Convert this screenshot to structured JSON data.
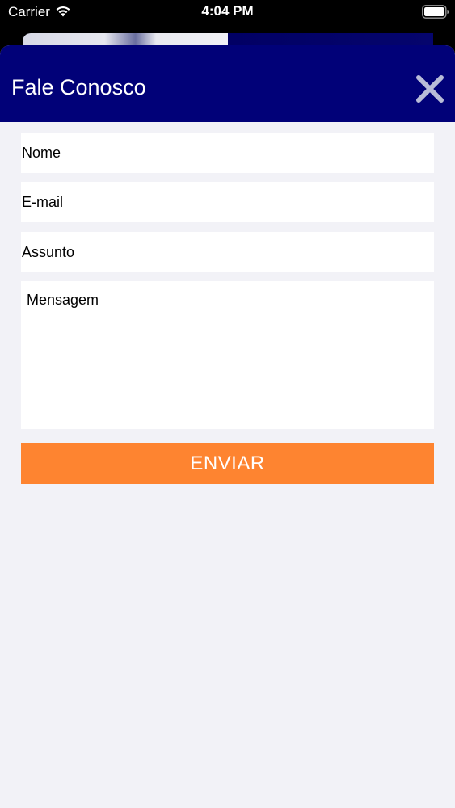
{
  "status_bar": {
    "carrier": "Carrier",
    "time": "4:04 PM",
    "wifi_icon": "wifi-icon",
    "battery_icon": "battery-icon"
  },
  "modal": {
    "title": "Fale Conosco",
    "close_icon": "close-icon",
    "header_color": "#010178"
  },
  "form": {
    "name_placeholder": "Nome",
    "email_placeholder": "E-mail",
    "subject_placeholder": "Assunto",
    "message_placeholder": "Mensagem",
    "name_value": "",
    "email_value": "",
    "subject_value": "",
    "message_value": "",
    "submit_label": "ENVIAR",
    "submit_color": "#fe8430"
  }
}
